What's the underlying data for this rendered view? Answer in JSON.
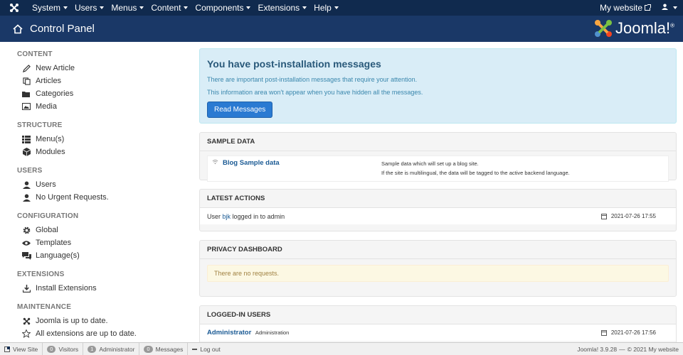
{
  "nav": {
    "items": [
      {
        "label": "System"
      },
      {
        "label": "Users"
      },
      {
        "label": "Menus"
      },
      {
        "label": "Content"
      },
      {
        "label": "Components"
      },
      {
        "label": "Extensions"
      },
      {
        "label": "Help"
      }
    ],
    "site_link": "My website"
  },
  "header": {
    "title": "Control Panel",
    "logo_text": "Joomla!",
    "logo_mark": "®"
  },
  "sidebar": {
    "sections": [
      {
        "header": "CONTENT",
        "items": [
          {
            "label": "New Article",
            "icon": "pencil-icon"
          },
          {
            "label": "Articles",
            "icon": "copy-icon"
          },
          {
            "label": "Categories",
            "icon": "folder-icon"
          },
          {
            "label": "Media",
            "icon": "image-icon"
          }
        ]
      },
      {
        "header": "STRUCTURE",
        "items": [
          {
            "label": "Menu(s)",
            "icon": "list-icon"
          },
          {
            "label": "Modules",
            "icon": "cube-icon"
          }
        ]
      },
      {
        "header": "USERS",
        "items": [
          {
            "label": "Users",
            "icon": "user-icon"
          },
          {
            "label": "No Urgent Requests.",
            "icon": "user-icon"
          }
        ]
      },
      {
        "header": "CONFIGURATION",
        "items": [
          {
            "label": "Global",
            "icon": "cog-icon"
          },
          {
            "label": "Templates",
            "icon": "eye-icon"
          },
          {
            "label": "Language(s)",
            "icon": "comments-icon"
          }
        ]
      },
      {
        "header": "EXTENSIONS",
        "items": [
          {
            "label": "Install Extensions",
            "icon": "download-icon"
          }
        ]
      },
      {
        "header": "MAINTENANCE",
        "items": [
          {
            "label": "Joomla is up to date.",
            "icon": "joomla-icon"
          },
          {
            "label": "All extensions are up to date.",
            "icon": "star-icon"
          }
        ]
      }
    ]
  },
  "postinstall": {
    "title": "You have post-installation messages",
    "line1": "There are important post-installation messages that require your attention.",
    "line2": "This information area won't appear when you have hidden all the messages.",
    "button": "Read Messages"
  },
  "sample_data": {
    "header": "SAMPLE DATA",
    "name": "Blog Sample data",
    "desc1": "Sample data which will set up a blog site.",
    "desc2": "If the site is multilingual, the data will be tagged to the active backend language."
  },
  "latest_actions": {
    "header": "LATEST ACTIONS",
    "text_before": "User",
    "user": "bjk",
    "text_after": "logged in to admin",
    "date": "2021-07-26 17:55"
  },
  "privacy": {
    "header": "PRIVACY DASHBOARD",
    "message": "There are no requests."
  },
  "logged_in": {
    "header": "LOGGED-IN USERS",
    "name": "Administrator",
    "role": "Administration",
    "date": "2021-07-26 17:56"
  },
  "status": {
    "view_site": "View Site",
    "visitors_count": "0",
    "visitors": "Visitors",
    "admin_count": "1",
    "admin": "Administrator",
    "messages_count": "0",
    "messages": "Messages",
    "logout": "Log out",
    "version": "Joomla! 3.9.28",
    "separator": "—",
    "copyright": "© 2021 My website"
  }
}
